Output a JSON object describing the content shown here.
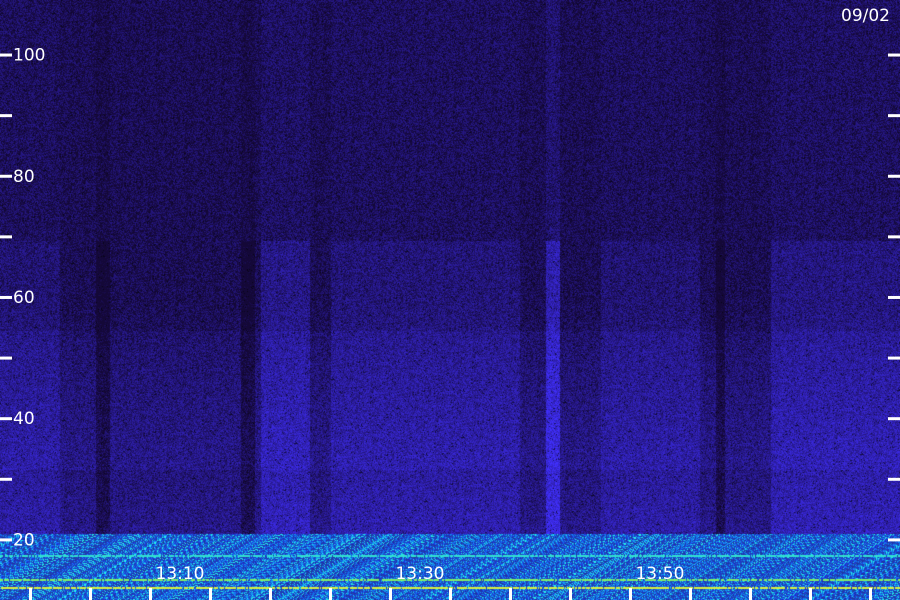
{
  "date_label": "09/02",
  "colors": {
    "background": "#160a3c",
    "noise_low": "#1a0a4a",
    "noise_mid": "#3a1aa8",
    "band_high": "#2a7cff",
    "line_cyan": "#33e0d0",
    "line_yellow": "#d8f040",
    "axis": "#ffffff"
  },
  "chart_data": {
    "type": "heatmap",
    "title": "",
    "xlabel": "",
    "ylabel": "",
    "ylim": [
      10,
      109
    ],
    "y_ticks_labeled": [
      20,
      40,
      60,
      80,
      100
    ],
    "y_ticks_minor": [
      30,
      50,
      70,
      90
    ],
    "x_tick_labels": [
      "13:10",
      "13:30",
      "13:50"
    ],
    "x_tick_label_values": [
      13.1667,
      13.5,
      13.8333
    ],
    "x_range": [
      12.9167,
      14.1667
    ],
    "x_tick_spacing_minutes": 5,
    "horizontal_lines": [
      {
        "y": 17.5,
        "color": "cyan"
      },
      {
        "y": 13.5,
        "color": "green"
      },
      {
        "y": 12.2,
        "color": "yellow"
      }
    ],
    "bright_vertical_streak_x": 13.68
  }
}
